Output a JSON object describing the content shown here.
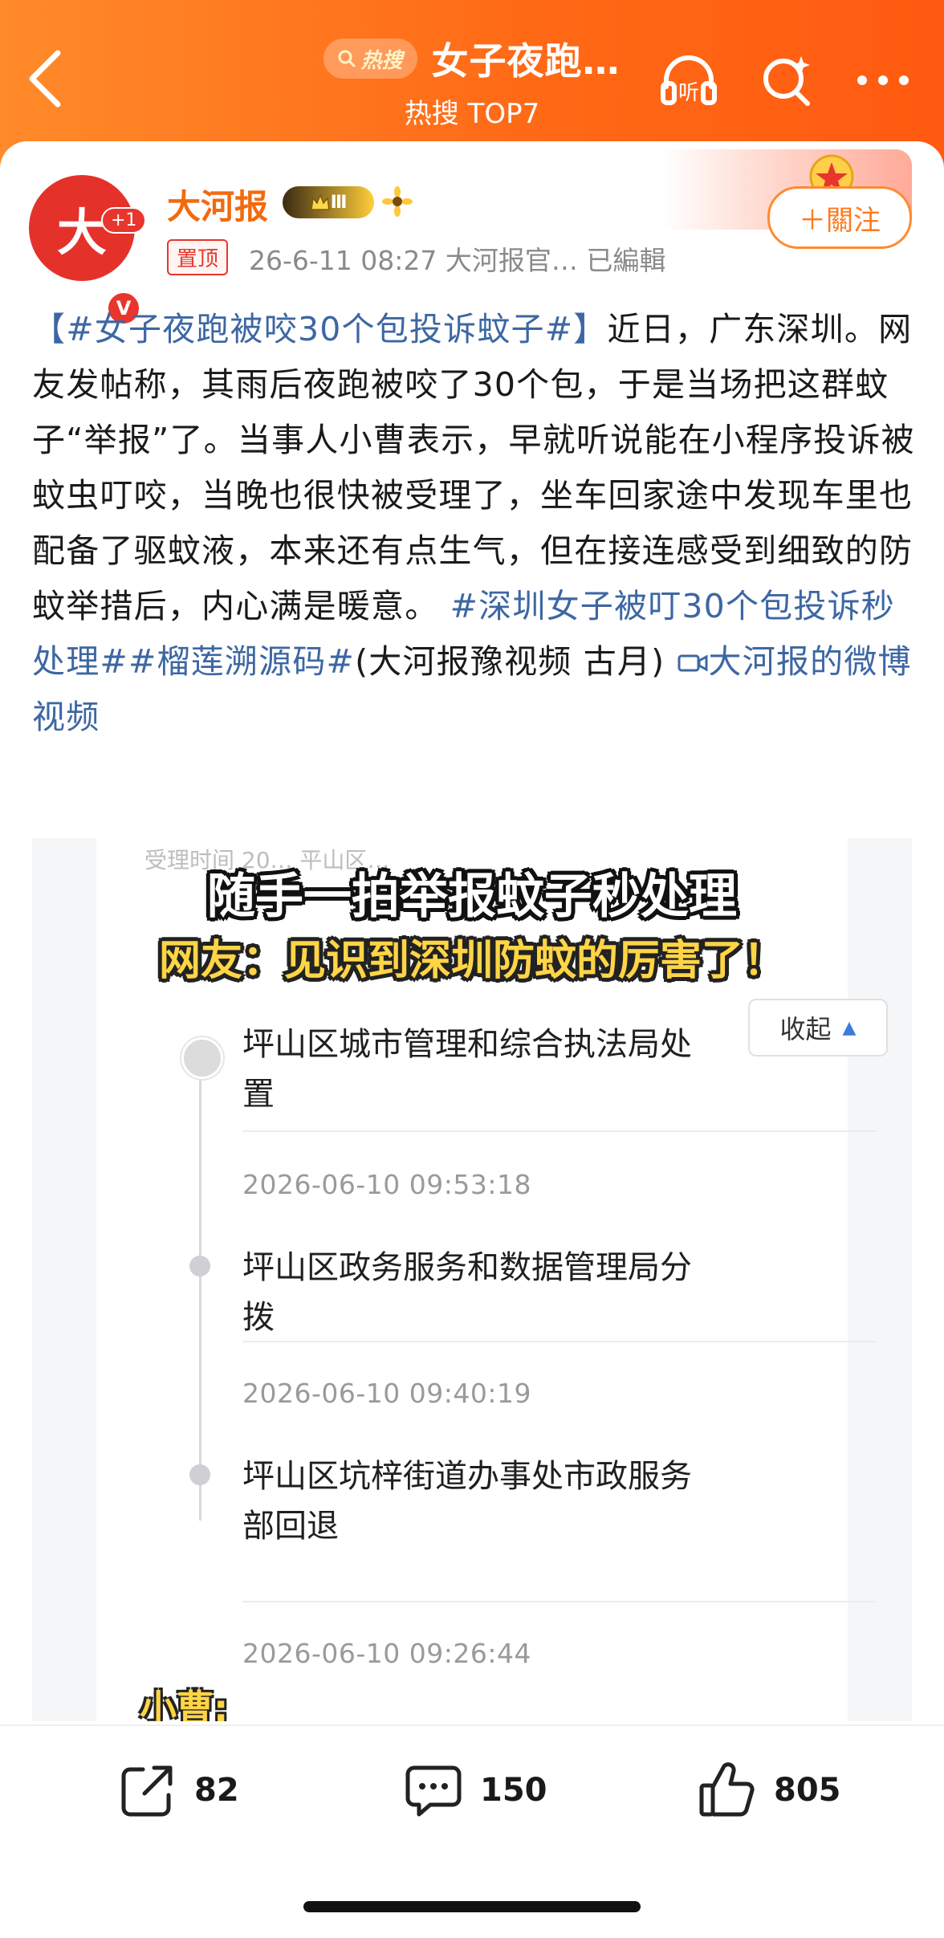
{
  "header": {
    "hot_badge": "热搜",
    "title": "女子夜跑…",
    "subtitle": "热搜 TOP7",
    "listen_label": "听",
    "colors": {
      "start": "#ff8a2a",
      "end": "#ff5a10"
    }
  },
  "post": {
    "author": {
      "name": "大河报",
      "avatar_text": "大",
      "notif": "+1",
      "verified": "V",
      "level": "Ⅲ"
    },
    "pin_label": "置顶",
    "meta": "26-6-11 08:27  大河报官…  已編輯",
    "follow_label": "＋關注",
    "text": {
      "hashtag1": "【#女子夜跑被咬30个包投诉蚊子#】",
      "body": "近日，广东深圳。网友发帖称，其雨后夜跑被咬了30个包，于是当场把这群蚊子“举报”了。当事人小曹表示，早就听说能在小程序投诉被蚊虫叮咬，当晚也很快被受理了，坐车回家途中发现车里也配备了驱蚊液，本来还有点生气，但在接连感受到细致的防蚊举措后，内心满是暖意。",
      "hashtag2": "#深圳女子被叮30个包投诉秒处理#",
      "hashtag3": "#榴莲溯源码#",
      "source": "(大河报豫视频 古月)",
      "video_link": "大河报的微博视频"
    }
  },
  "video": {
    "caption1": "随手一拍举报蚊子秒处理",
    "caption2": "网友：见识到深圳防蚊的厉害了！",
    "faded_top": "受理时间   20…   平山区…",
    "collapse_label": "收起",
    "timeline": [
      {
        "title": "坪山区城市管理和综合执法局处置",
        "date": "2026-06-10 09:53:18"
      },
      {
        "title": "坪山区政务服务和数据管理局分拨",
        "date": "2026-06-10 09:40:19"
      },
      {
        "title": "坪山区坑梓街道办事处市政服务部回退",
        "date": "2026-06-10 09:26:44"
      }
    ],
    "speaker_caption": "小曹:"
  },
  "actions": {
    "share_count": "82",
    "comment_count": "150",
    "like_count": "805"
  }
}
